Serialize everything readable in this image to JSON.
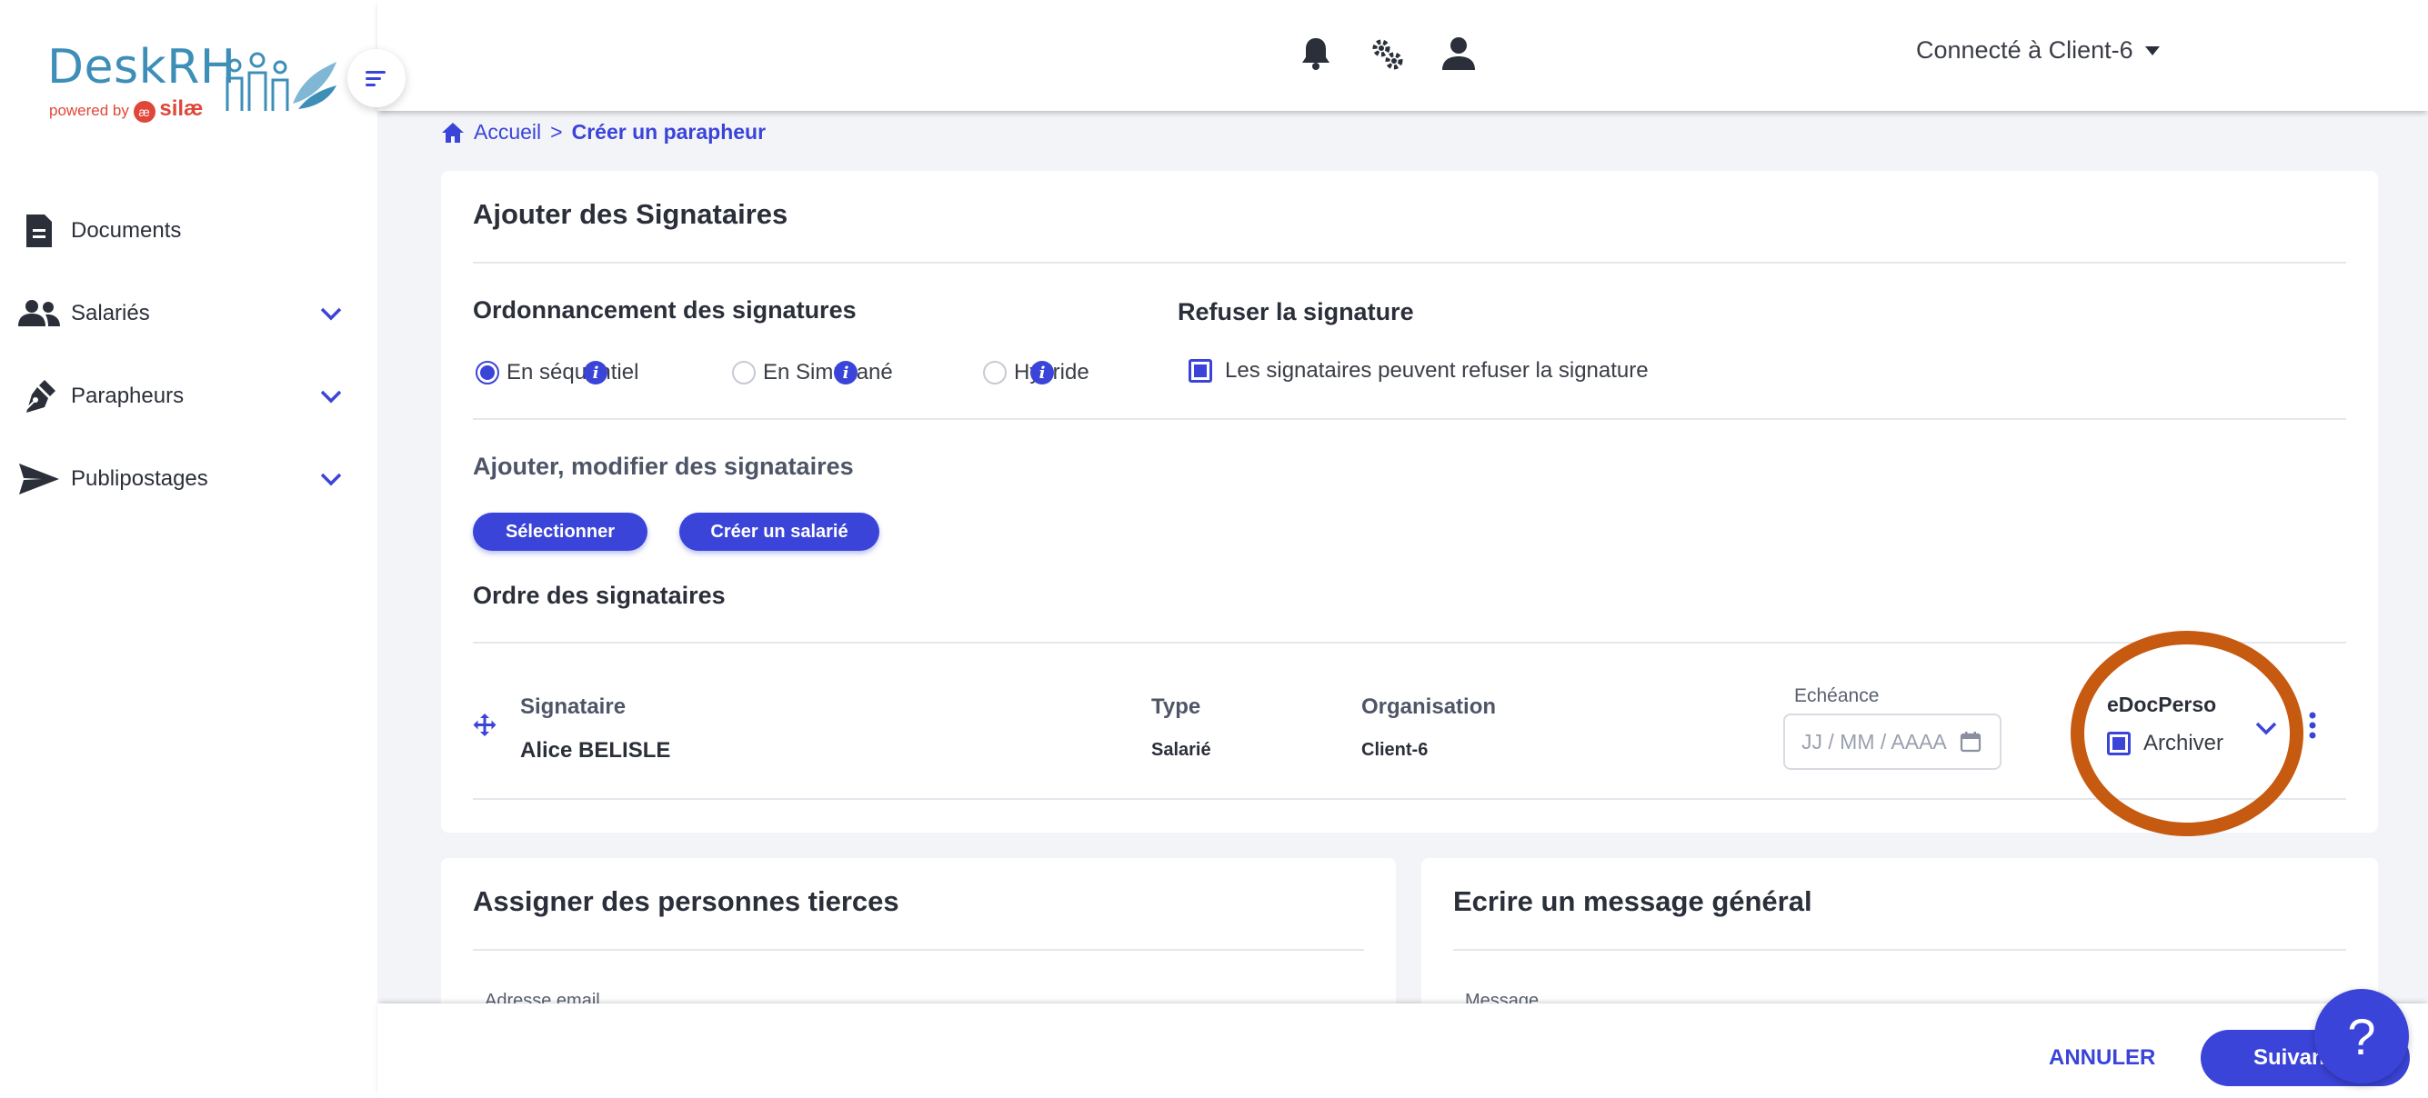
{
  "brand": {
    "name": "DeskRH",
    "powered_by": "powered by",
    "partner": "silæ",
    "partner_mark": "æ"
  },
  "sidebar": {
    "items": [
      {
        "label": "Documents",
        "icon": "document-icon",
        "expandable": false
      },
      {
        "label": "Salariés",
        "icon": "users-icon",
        "expandable": true
      },
      {
        "label": "Parapheurs",
        "icon": "pen-icon",
        "expandable": true
      },
      {
        "label": "Publipostages",
        "icon": "send-icon",
        "expandable": true
      }
    ]
  },
  "topbar": {
    "client": "Connecté à Client-6",
    "icons": [
      "bell-icon",
      "gear-icon",
      "user-icon"
    ]
  },
  "breadcrumb": {
    "home": "Accueil",
    "separator": ">",
    "current": "Créer un parapheur"
  },
  "signers_card": {
    "title": "Ajouter des Signataires",
    "ordering": {
      "title": "Ordonnancement des signatures",
      "options": [
        {
          "label": "En séquentiel",
          "checked": true
        },
        {
          "label": "En Simultané",
          "checked": false
        },
        {
          "label": "Hybride",
          "checked": false
        }
      ],
      "info_glyph": "i"
    },
    "refuse": {
      "title": "Refuser la signature",
      "checkbox_label": "Les signataires peuvent refuser la signature",
      "checked": true
    },
    "add_modify": {
      "title": "Ajouter, modifier des signataires",
      "select_button": "Sélectionner",
      "create_button": "Créer un salarié"
    },
    "order": {
      "title": "Ordre des signataires",
      "columns": {
        "signer": "Signataire",
        "type": "Type",
        "organisation": "Organisation",
        "deadline": "Echéance",
        "edocperso": "eDocPerso"
      },
      "rows": [
        {
          "signer": "Alice BELISLE",
          "type": "Salarié",
          "organisation": "Client-6",
          "deadline_placeholder": "JJ / MM / AAAA",
          "archive_label": "Archiver",
          "archive_checked": true
        }
      ]
    }
  },
  "third_party_card": {
    "title": "Assigner des personnes tierces",
    "field_label": "Adresse email"
  },
  "message_card": {
    "title": "Ecrire un message général",
    "field_label": "Message"
  },
  "footer": {
    "cancel": "ANNULER",
    "next": "Suivant"
  },
  "help": {
    "glyph": "?"
  },
  "colors": {
    "accent": "#3b44d9",
    "annotation": "#c55a10",
    "logo": "#3d8fb8",
    "logo_partner": "#e0463a"
  }
}
